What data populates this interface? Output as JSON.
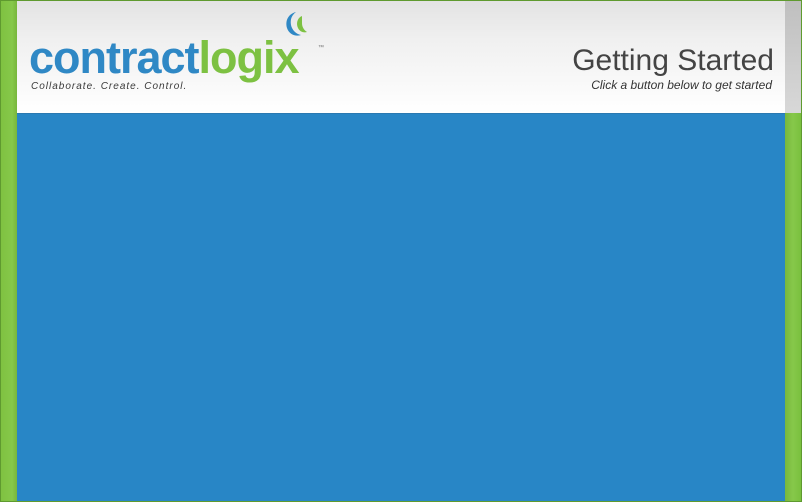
{
  "brand": {
    "logo_contract": "contract",
    "logo_logix": "logix",
    "logo_tm": "™",
    "tagline": "Collaborate. Create. Control."
  },
  "header": {
    "title": "Getting Started",
    "subtitle": "Click a button below to get started"
  },
  "colors": {
    "brand_blue": "#2886c6",
    "brand_green": "#7dc142",
    "header_gray": "#f0f0f0",
    "title_gray": "#444444"
  },
  "icons": {
    "brand_mark": "swoosh-icon"
  }
}
